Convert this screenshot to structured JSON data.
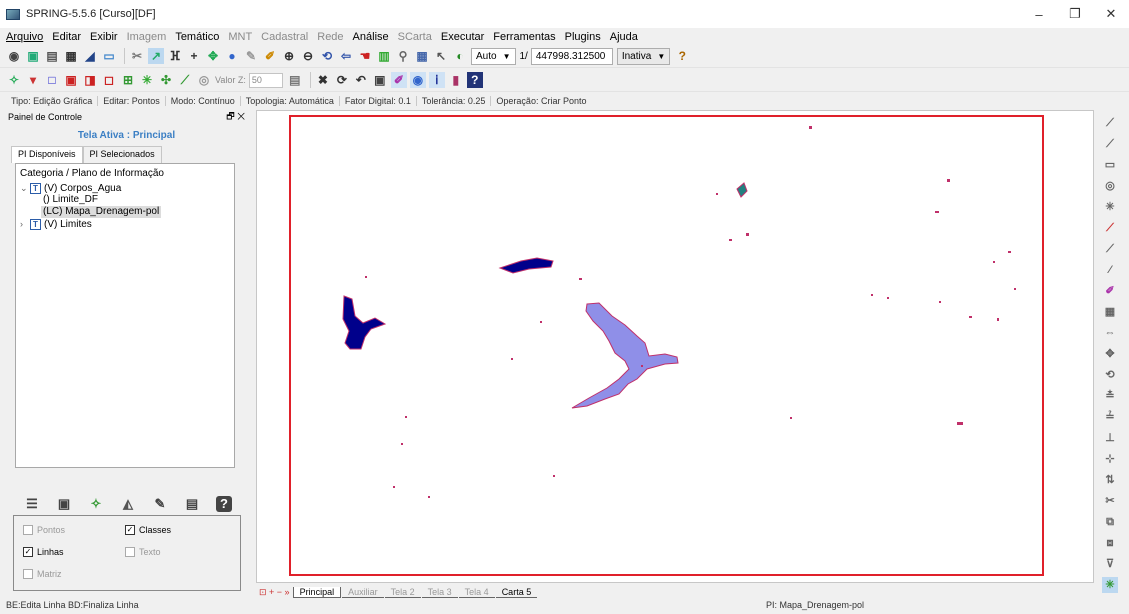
{
  "window": {
    "title": "SPRING-5.5.6 [Curso][DF]",
    "controls": [
      "–",
      "❐",
      "✕"
    ]
  },
  "menu": [
    {
      "label": "Arquivo",
      "enabled": true
    },
    {
      "label": "Editar",
      "enabled": true
    },
    {
      "label": "Exibir",
      "enabled": true
    },
    {
      "label": "Imagem",
      "enabled": false
    },
    {
      "label": "Temático",
      "enabled": true
    },
    {
      "label": "MNT",
      "enabled": false
    },
    {
      "label": "Cadastral",
      "enabled": false
    },
    {
      "label": "Rede",
      "enabled": false
    },
    {
      "label": "Análise",
      "enabled": true
    },
    {
      "label": "SCarta",
      "enabled": false
    },
    {
      "label": "Executar",
      "enabled": true
    },
    {
      "label": "Ferramentas",
      "enabled": true
    },
    {
      "label": "Plugins",
      "enabled": true
    },
    {
      "label": "Ajuda",
      "enabled": true
    }
  ],
  "toolbar1": {
    "zoom_mode": "Auto",
    "scale_prefix": "1/",
    "scale_value": "447998.312500",
    "state": "Inativa",
    "help_icon": "?"
  },
  "toolbar2": {
    "valor_z_label": "Valor Z:",
    "valor_z_value": "50"
  },
  "status_info": [
    "Tipo: Edição Gráfica",
    "Editar: Pontos",
    "Modo: Contínuo",
    "Topologia: Automática",
    "Fator Digital: 0.1",
    "Tolerância: 0.25",
    "Operação: Criar Ponto"
  ],
  "panel": {
    "title": "Painel de Controle",
    "header_icons": "🗗 ✕",
    "active_screen": "Tela Ativa : Principal",
    "tabs": [
      "PI Disponíveis",
      "PI Selecionados"
    ],
    "tree_header": "Categoria / Plano de Informação",
    "tree": {
      "cat1_label": "(V) Corpos_Agua",
      "cat1_type": "T",
      "child1": "() Limite_DF",
      "child2": "(LC) Mapa_Drenagem-pol",
      "cat2_label": "(V) Limites",
      "cat2_type": "T"
    },
    "options": {
      "pontos": "Pontos",
      "classes": "Classes",
      "linhas": "Linhas",
      "texto": "Texto",
      "matriz": "Matriz",
      "check_mark": "✓"
    }
  },
  "canvas_tabs": {
    "nav": "⊡ + − »",
    "tabs": [
      "Principal",
      "Auxiliar",
      "Tela 2",
      "Tela 3",
      "Tela 4",
      "Carta 5"
    ]
  },
  "statusbar": {
    "left": "BE:Edita Linha  BD:Finaliza Linha",
    "right": "PI: Mapa_Drenagem-pol"
  },
  "colors": {
    "frame": "#e0202a",
    "water_dark": "#00008b",
    "water_light": "#8f8fe8",
    "polygon_edge": "#c0306a",
    "accent_blue": "#3b7fc4"
  }
}
